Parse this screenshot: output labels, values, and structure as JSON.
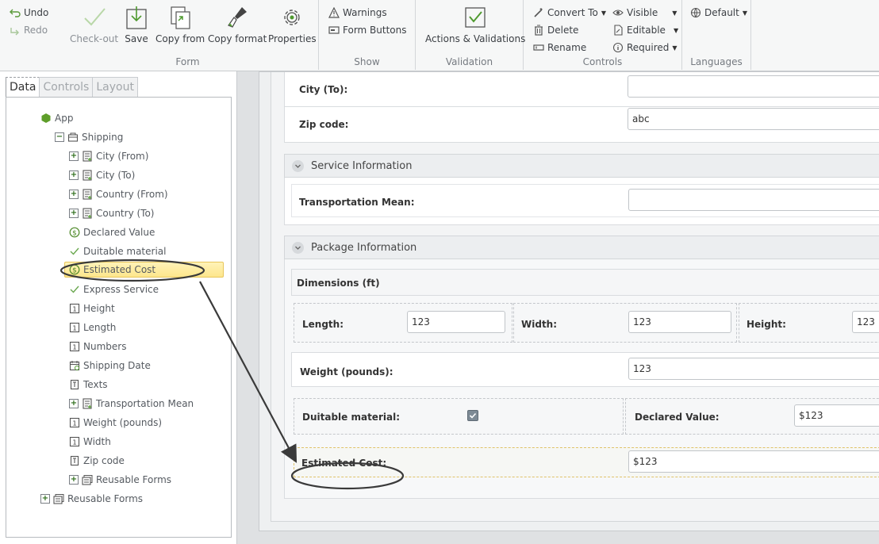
{
  "ribbon": {
    "undo": "Undo",
    "redo": "Redo",
    "form_group": {
      "label": "Form",
      "checkout": "Check-out",
      "save": "Save",
      "copy_from": "Copy from",
      "copy_format": "Copy format",
      "properties": "Properties"
    },
    "show_group": {
      "label": "Show",
      "warnings": "Warnings",
      "form_buttons": "Form Buttons"
    },
    "validation_group": {
      "label": "Validation",
      "actions_validations": "Actions & Validations"
    },
    "controls_group": {
      "label": "Controls",
      "convert_to": "Convert To",
      "delete": "Delete",
      "rename": "Rename",
      "visible": "Visible",
      "editable": "Editable",
      "required": "Required"
    },
    "languages_group": {
      "label": "Languages",
      "default": "Default"
    }
  },
  "left_tabs": [
    "Data",
    "Controls",
    "Layout"
  ],
  "tree": {
    "app": "App",
    "shipping": "Shipping",
    "city_from": "City (From)",
    "city_to": "City (To)",
    "country_from": "Country (From)",
    "country_to": "Country (To)",
    "declared_value": "Declared Value",
    "duitable_material": "Duitable material",
    "estimated_cost": "Estimated Cost",
    "express_service": "Express Service",
    "height": "Height",
    "length": "Length",
    "numbers": "Numbers",
    "shipping_date": "Shipping Date",
    "texts": "Texts",
    "transportation_mean": "Transportation Mean",
    "weight": "Weight (pounds)",
    "width": "Width",
    "zip_code": "Zip code",
    "reusable_forms_inner": "Reusable Forms",
    "reusable_forms_root": "Reusable Forms"
  },
  "form": {
    "city_to_label": "City (To):",
    "city_to_value": "",
    "zip_label": "Zip code:",
    "zip_value": "abc",
    "service_section": "Service Information",
    "transport_label": "Transportation Mean:",
    "transport_value": "",
    "package_section": "Package Information",
    "dimensions_label": "Dimensions (ft)",
    "length_label": "Length:",
    "length_value": "123",
    "width_label": "Width:",
    "width_value": "123",
    "height_label": "Height:",
    "height_value": "123",
    "weight_label": "Weight (pounds):",
    "weight_value": "123",
    "duitable_label": "Duitable material:",
    "declared_label": "Declared Value:",
    "declared_value": "$123",
    "estimated_label": "Estimated Cost:",
    "estimated_value": "$123"
  }
}
